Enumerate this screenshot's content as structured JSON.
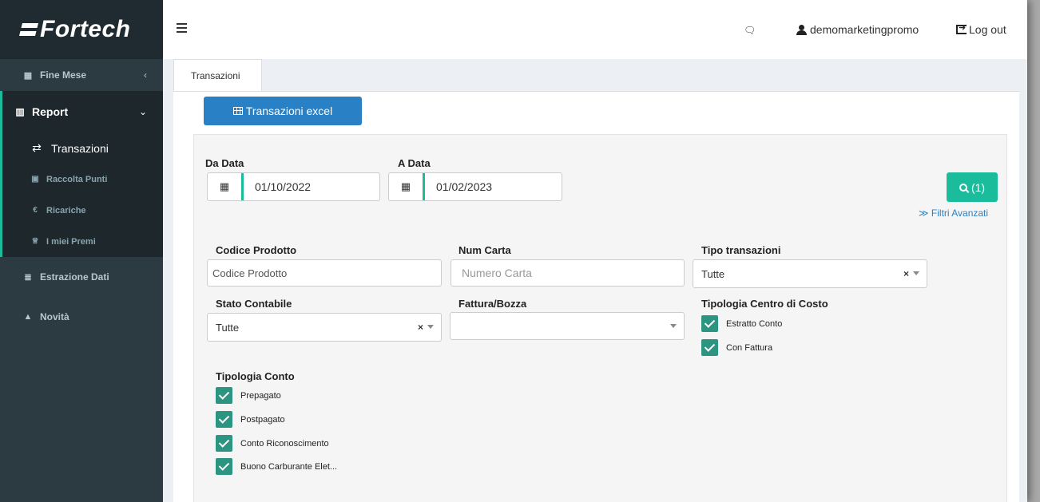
{
  "brand": {
    "name": "Fortech"
  },
  "sidebar": {
    "items": [
      {
        "label": "Fine Mese",
        "icon": "calendar-icon"
      },
      {
        "label": "Report",
        "icon": "bar-chart-icon",
        "expanded": true,
        "children": [
          {
            "label": "Transazioni",
            "icon": "exchange-icon",
            "active": true
          },
          {
            "label": "Raccolta Punti",
            "icon": "gift-icon"
          },
          {
            "label": "Ricariche",
            "icon": "euro-icon"
          },
          {
            "label": "I miei Premi",
            "icon": "trophy-icon"
          }
        ]
      },
      {
        "label": "Estrazione Dati",
        "icon": "database-icon"
      },
      {
        "label": "Novità",
        "icon": "bell-icon"
      }
    ]
  },
  "header": {
    "username": "demomarketingpromo",
    "logout_label": "Log out"
  },
  "tabs": [
    {
      "label": "Transazioni",
      "active": true
    }
  ],
  "toolbar": {
    "excel_label": "Transazioni excel"
  },
  "filters": {
    "da_data": {
      "label": "Da Data",
      "value": "01/10/2022"
    },
    "a_data": {
      "label": "A Data",
      "value": "01/02/2023"
    },
    "search_label": "(1)",
    "advanced_label": "Filtri Avanzati",
    "codice_prodotto": {
      "label": "Codice Prodotto",
      "value": "Codice Prodotto"
    },
    "num_carta": {
      "label": "Num Carta",
      "placeholder": "Numero Carta"
    },
    "tipo_transazioni": {
      "label": "Tipo transazioni",
      "value": "Tutte"
    },
    "stato_contabile": {
      "label": "Stato Contabile",
      "value": "Tutte"
    },
    "fattura_bozza": {
      "label": "Fattura/Bozza",
      "value": ""
    },
    "centro_costo": {
      "label": "Tipologia Centro di Costo",
      "options": [
        {
          "label": "Estratto Conto",
          "checked": true
        },
        {
          "label": "Con Fattura",
          "checked": true
        }
      ]
    },
    "tipologia_conto": {
      "label": "Tipologia Conto",
      "options": [
        {
          "label": "Prepagato",
          "checked": true
        },
        {
          "label": "Postpagato",
          "checked": true
        },
        {
          "label": "Conto Riconoscimento",
          "checked": true
        },
        {
          "label": "Buono Carburante Elet...",
          "checked": true
        }
      ]
    }
  },
  "colors": {
    "sidebar_bg": "#2c3b41",
    "accent": "#1abc9c",
    "primary": "#2a80c4",
    "checkbox": "#2b9582"
  }
}
